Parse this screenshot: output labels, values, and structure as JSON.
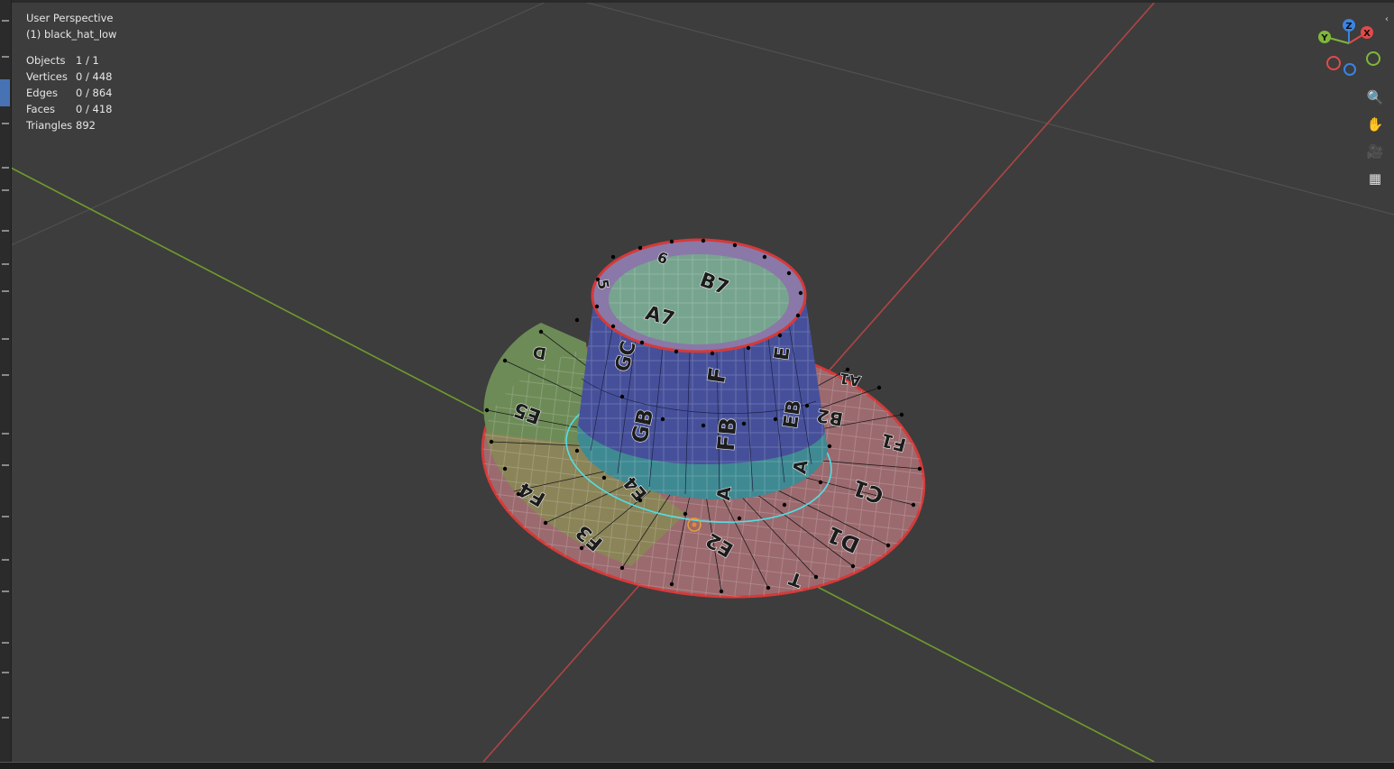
{
  "viewport": {
    "view_name": "User Perspective",
    "object_name": "(1) black_hat_low"
  },
  "stats": [
    {
      "label": "Objects",
      "value": "1 / 1"
    },
    {
      "label": "Vertices",
      "value": "0 / 448"
    },
    {
      "label": "Edges",
      "value": "0 / 864"
    },
    {
      "label": "Faces",
      "value": "0 / 418"
    },
    {
      "label": "Triangles",
      "value": "892"
    }
  ],
  "gizmo": {
    "x_label": "X",
    "y_label": "Y",
    "z_label": "Z",
    "colors": {
      "x": "#e24a4a",
      "y": "#7fb73a",
      "z": "#3a84e2"
    }
  },
  "nav_buttons": [
    {
      "name": "zoom-icon",
      "glyph": "🔍"
    },
    {
      "name": "hand-pan-icon",
      "glyph": "✋"
    },
    {
      "name": "camera-icon",
      "glyph": "🎥"
    },
    {
      "name": "grid-icon",
      "glyph": "▦"
    }
  ],
  "uv_labels": {
    "top": [
      "B7",
      "A7",
      "6",
      "5"
    ],
    "crown": [
      "GC",
      "F",
      "E",
      "GB",
      "FB",
      "EB"
    ],
    "band": [
      "A",
      "A"
    ],
    "brim_left": [
      "E5",
      "F4",
      "F3",
      "D",
      "E4"
    ],
    "brim_right": [
      "B2",
      "C1",
      "D1",
      "E2",
      "F1",
      "T",
      "A1"
    ]
  }
}
